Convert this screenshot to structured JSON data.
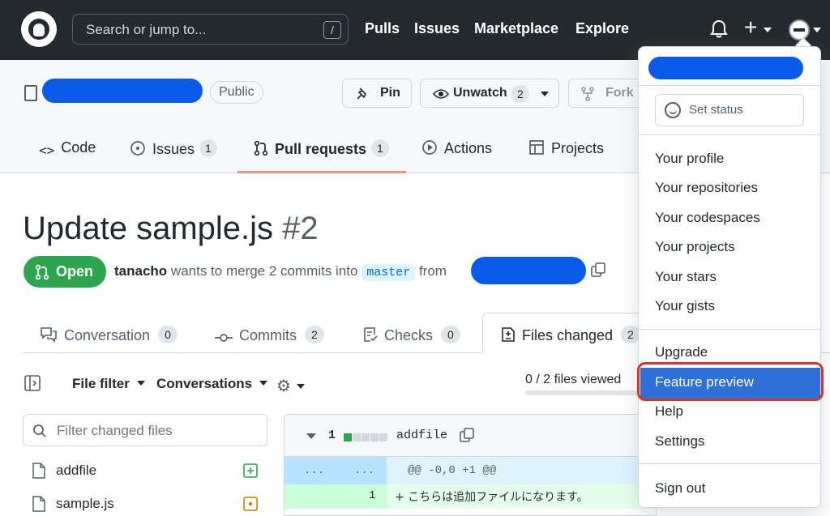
{
  "topbar": {
    "search_placeholder": "Search or jump to...",
    "search_shortcut": "/",
    "nav": [
      "Pulls",
      "Issues",
      "Marketplace",
      "Explore"
    ]
  },
  "repo": {
    "visibility": "Public",
    "pin_label": "Pin",
    "unwatch_label": "Unwatch",
    "unwatch_count": "2",
    "fork_label": "Fork"
  },
  "repo_tabs": [
    {
      "label": "Code",
      "icon": "code-icon"
    },
    {
      "label": "Issues",
      "count": "1",
      "icon": "issue-icon"
    },
    {
      "label": "Pull requests",
      "count": "1",
      "icon": "pull-request-icon"
    },
    {
      "label": "Actions",
      "icon": "play-icon"
    },
    {
      "label": "Projects",
      "icon": "table-icon"
    }
  ],
  "pr": {
    "title": "Update sample.js",
    "number": "#2",
    "status": "Open",
    "author": "tanacho",
    "merge_text": "wants to merge 2 commits into",
    "base_branch": "master",
    "from_text": "from"
  },
  "pr_tabs": [
    {
      "label": "Conversation",
      "count": "0"
    },
    {
      "label": "Commits",
      "count": "2"
    },
    {
      "label": "Checks",
      "count": "0"
    },
    {
      "label": "Files changed",
      "count": "2"
    }
  ],
  "toolbar": {
    "file_filter": "File filter",
    "conversations": "Conversations",
    "files_viewed": "0 / 2 files viewed",
    "files_viewed_fraction": 0
  },
  "file_tree": {
    "filter_placeholder": "Filter changed files",
    "files": [
      {
        "name": "addfile",
        "status": "added"
      },
      {
        "name": "sample.js",
        "status": "modified"
      }
    ]
  },
  "diff": {
    "changes": "1",
    "file": "addfile",
    "hunk_left": "...",
    "hunk_right": "...",
    "hunk_header": "@@ -0,0 +1 @@",
    "line_number": "1",
    "line_text": "+ こちらは追加ファイルになります。"
  },
  "user_menu": {
    "set_status": "Set status",
    "items_group1": [
      "Your profile",
      "Your repositories",
      "Your codespaces",
      "Your projects",
      "Your stars",
      "Your gists"
    ],
    "upgrade": "Upgrade",
    "feature_preview": "Feature preview",
    "help": "Help",
    "settings": "Settings",
    "sign_out": "Sign out"
  },
  "colors": {
    "header_bg": "#24292f",
    "open_green": "#2da44e",
    "highlight_blue": "#2f6fd8",
    "redaction_blue": "#0a5ce8",
    "annotation_red": "#d1372b"
  }
}
